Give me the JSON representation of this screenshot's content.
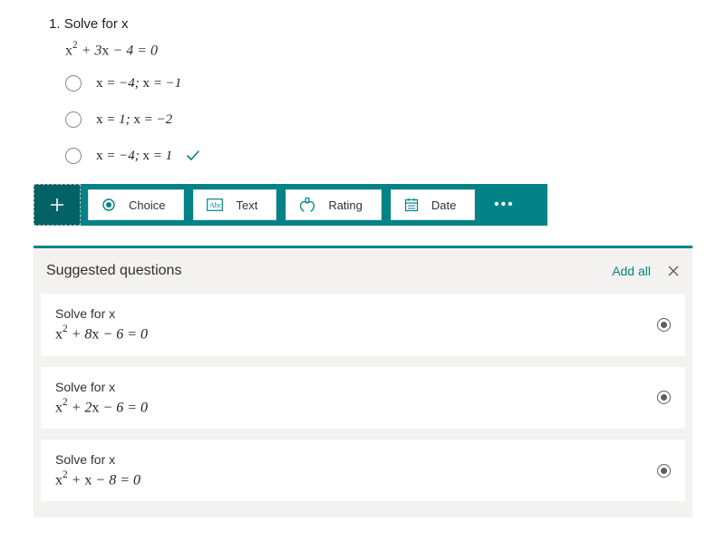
{
  "question": {
    "number": "1.",
    "title": "Solve for x",
    "equation_html": "<span class=\"eq-norm\">x</span><sup>2</sup> + 3<span class=\"eq-norm\">x</span> − 4 = 0",
    "options": [
      {
        "html": "<span class=\"eq-norm\">x</span> = −4; <span class=\"eq-norm\">x</span> = −1",
        "correct": false
      },
      {
        "html": "<span class=\"eq-norm\">x</span> = 1; <span class=\"eq-norm\">x</span> = −2",
        "correct": false
      },
      {
        "html": "<span class=\"eq-norm\">x</span> = −4; <span class=\"eq-norm\">x</span> = 1",
        "correct": true
      }
    ]
  },
  "toolbar": {
    "choice": "Choice",
    "text": "Text",
    "rating": "Rating",
    "date": "Date"
  },
  "suggested": {
    "title": "Suggested questions",
    "add_all": "Add all",
    "items": [
      {
        "title": "Solve for x",
        "equation_html": "<span class=\"eq-norm\">x</span><sup>2</sup> + 8<span class=\"eq-norm\">x</span> − 6 = 0"
      },
      {
        "title": "Solve for x",
        "equation_html": "<span class=\"eq-norm\">x</span><sup>2</sup> + 2<span class=\"eq-norm\">x</span> − 6 = 0"
      },
      {
        "title": "Solve for x",
        "equation_html": "<span class=\"eq-norm\">x</span><sup>2</sup> + <span class=\"eq-norm\">x</span> − 8 = 0"
      }
    ]
  }
}
